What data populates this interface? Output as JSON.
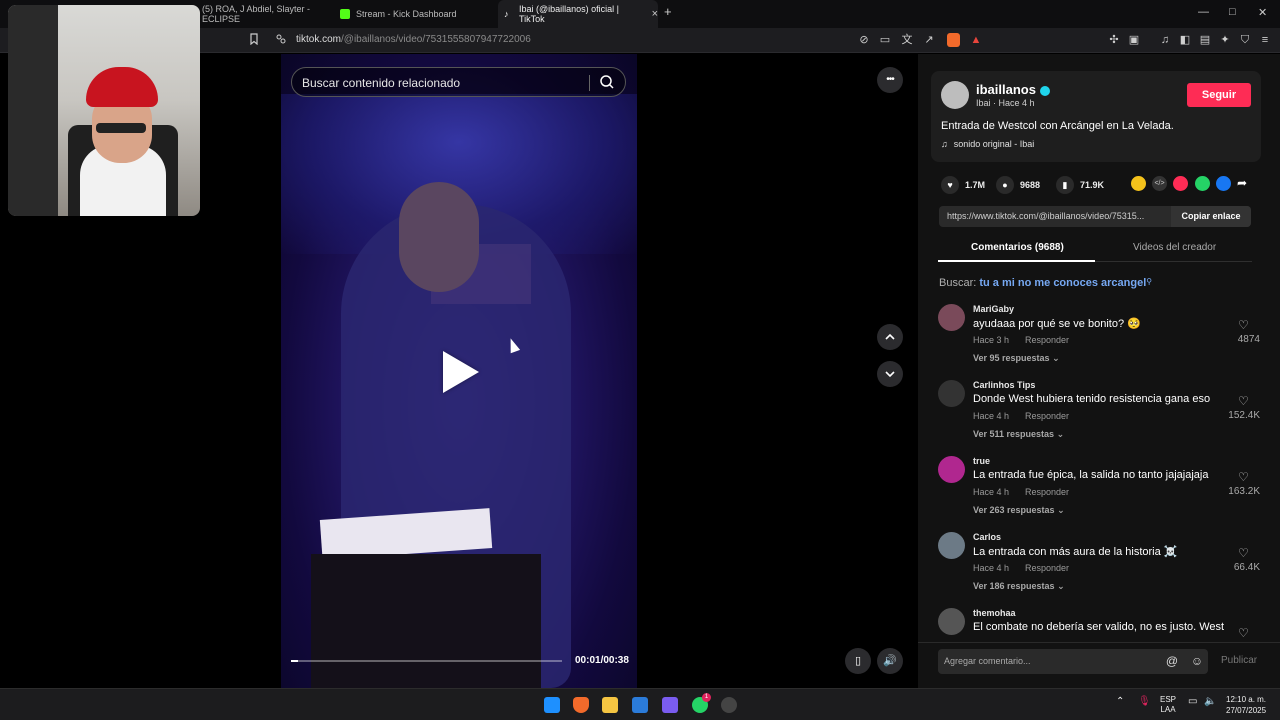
{
  "browser": {
    "tabs": [
      {
        "label": "(5) ROA, J Abdiel, Slayter - ECLIPSE"
      },
      {
        "label": "Stream - Kick Dashboard"
      },
      {
        "label": "Ibai (@ibaillanos) oficial | TikTok",
        "close": "×"
      }
    ],
    "new_tab": "+",
    "url_host": "tiktok.com",
    "url_path": "/@ibaillanos/video/7531555807947722006",
    "window_controls": {
      "minimize": "—",
      "maximize": "□",
      "close": "✕"
    }
  },
  "video": {
    "search_placeholder": "Buscar contenido relacionado",
    "time": "00:01/00:38",
    "progress_fraction": 0.026,
    "more_button": "•••"
  },
  "post": {
    "author": "ibaillanos",
    "meta": "Ibai · Hace 4 h",
    "follow_label": "Seguir",
    "description": "Entrada de Westcol con Arcángel en La Velada.",
    "sound": "sonido original - Ibai",
    "likes": "1.7M",
    "comments": "9688",
    "saves": "71.9K",
    "link": "https://www.tiktok.com/@ibaillanos/video/75315...",
    "copy_label": "Copiar enlace"
  },
  "tabs": {
    "comments": "Comentarios (9688)",
    "creator_videos": "Videos del creador"
  },
  "search_suggestion": {
    "prefix": "Buscar:",
    "query": "tu a mi no me conoces arcangel"
  },
  "comments": [
    {
      "user": "MariGaby",
      "text": "ayudaaa por qué se ve bonito? 🥺",
      "when": "Hace 3 h",
      "reply": "Responder",
      "more": "Ver 95 respuestas",
      "likes": "4874",
      "avatar_color": "#7a4a5a"
    },
    {
      "user": "Carlinhos Tips",
      "text": "Donde West hubiera tenido resistencia gana eso",
      "when": "Hace 4 h",
      "reply": "Responder",
      "more": "Ver 511 respuestas",
      "likes": "152.4K",
      "avatar_color": "#333333"
    },
    {
      "user": "true",
      "text": "La entrada fue épica, la salida no tanto jajajajaja",
      "when": "Hace 4 h",
      "reply": "Responder",
      "more": "Ver 263 respuestas",
      "likes": "163.2K",
      "avatar_color": "#b0278f"
    },
    {
      "user": "Carlos",
      "text": "La entrada con más aura de la historia ☠️",
      "when": "Hace 4 h",
      "reply": "Responder",
      "more": "Ver 186 respuestas",
      "likes": "66.4K",
      "avatar_color": "#6c7a86"
    },
    {
      "user": "themohaa",
      "text": "El combate no debería ser valido, no es justo. West",
      "when": "",
      "reply": "",
      "more": "",
      "likes": "",
      "avatar_color": "#555555"
    }
  ],
  "compose": {
    "placeholder": "Agregar comentario...",
    "publish": "Publicar"
  },
  "taskbar": {
    "lang_top": "ESP",
    "lang_bottom": "LAA",
    "time": "12:10 a. m.",
    "date": "27/07/2025",
    "whatsapp_badge": "1"
  },
  "colors": {
    "accent": "#fe2c55",
    "verified": "#20d5ec",
    "link_blue": "#76a8f2"
  }
}
